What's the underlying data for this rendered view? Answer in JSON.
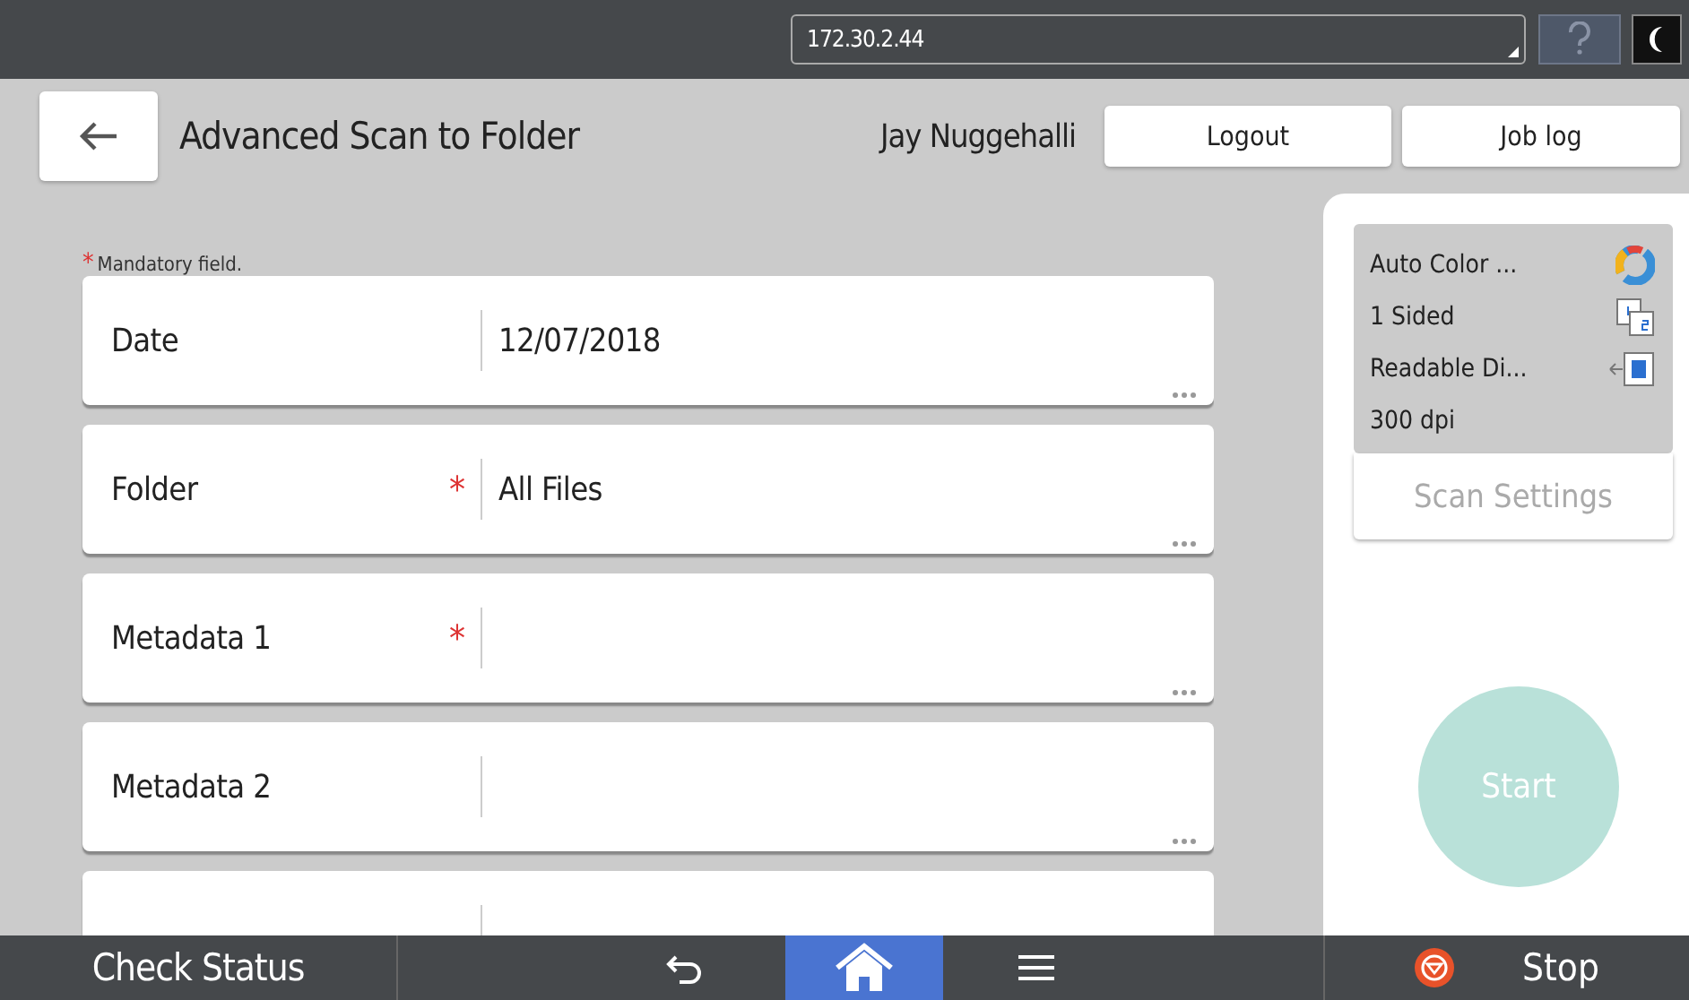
{
  "top_bar": {
    "address": "172.30.2.44"
  },
  "header": {
    "title": "Advanced Scan to Folder",
    "user": "Jay Nuggehalli",
    "buttons": [
      "Logout",
      "Job log"
    ]
  },
  "required_mark": "*",
  "mandatory_note": "Mandatory field.",
  "fields": [
    {
      "label": "Date",
      "required": false,
      "value": "12/07/2018"
    },
    {
      "label": "Folder",
      "required": true,
      "value": "All Files"
    },
    {
      "label": "Metadata 1",
      "required": true
    },
    {
      "label": "Metadata 2",
      "required": false
    },
    {
      "required": false
    }
  ],
  "scan_settings": {
    "items": [
      {
        "text": "Auto Color ...",
        "kind": "color"
      },
      {
        "text": "1 Sided",
        "kind": "sides"
      },
      {
        "text": "Readable Di...",
        "kind": "direction"
      },
      {
        "text": "300 dpi",
        "kind": "none"
      }
    ],
    "button": "Scan Settings"
  },
  "start_button": "Start",
  "bottom_bar": {
    "check_status": "Check Status",
    "stop": "Stop",
    "home_selected": true
  }
}
